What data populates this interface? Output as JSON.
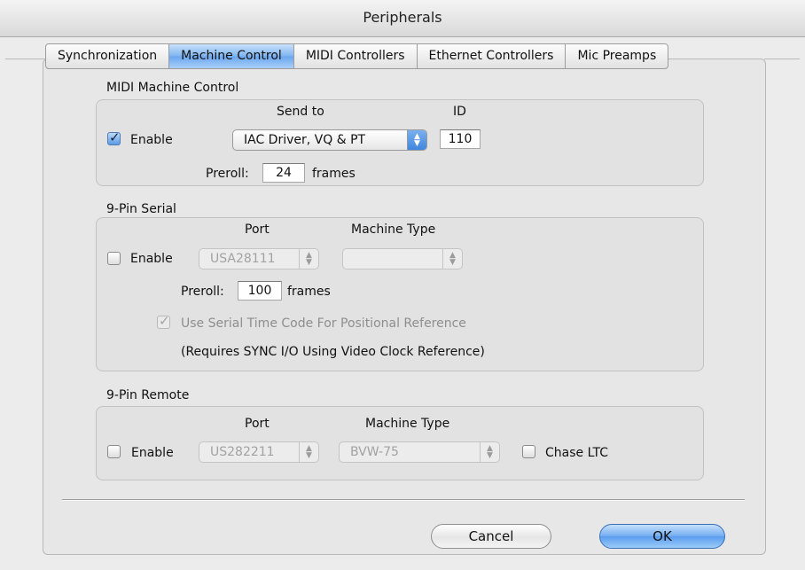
{
  "window": {
    "title": "Peripherals"
  },
  "tabs": [
    {
      "label": "Synchronization",
      "selected": false
    },
    {
      "label": "Machine Control",
      "selected": true
    },
    {
      "label": "MIDI Controllers",
      "selected": false
    },
    {
      "label": "Ethernet Controllers",
      "selected": false
    },
    {
      "label": "Mic Preamps",
      "selected": false
    }
  ],
  "midi_machine_control": {
    "title": "MIDI Machine Control",
    "send_to_header": "Send to",
    "id_header": "ID",
    "enable_label": "Enable",
    "enable_checked": true,
    "send_to_value": "IAC Driver, VQ & PT",
    "id_value": "110",
    "preroll_label": "Preroll:",
    "preroll_value": "24",
    "frames_label": "frames"
  },
  "nine_pin_serial": {
    "title": "9-Pin Serial",
    "port_header": "Port",
    "machine_type_header": "Machine Type",
    "enable_label": "Enable",
    "enable_checked": false,
    "port_value": "USA28111",
    "machine_type_value": "",
    "preroll_label": "Preroll:",
    "preroll_value": "100",
    "frames_label": "frames",
    "serial_tc_label": "Use Serial Time Code For Positional Reference",
    "serial_tc_checked": true,
    "note": "(Requires SYNC I/O Using Video Clock Reference)"
  },
  "nine_pin_remote": {
    "title": "9-Pin Remote",
    "port_header": "Port",
    "machine_type_header": "Machine Type",
    "enable_label": "Enable",
    "enable_checked": false,
    "port_value": "US282211",
    "machine_type_value": "BVW-75",
    "chase_ltc_label": "Chase LTC",
    "chase_ltc_checked": false
  },
  "buttons": {
    "cancel": "Cancel",
    "ok": "OK"
  },
  "icons": {
    "checkmark": "✓",
    "popup_arrows": "▲▼"
  }
}
